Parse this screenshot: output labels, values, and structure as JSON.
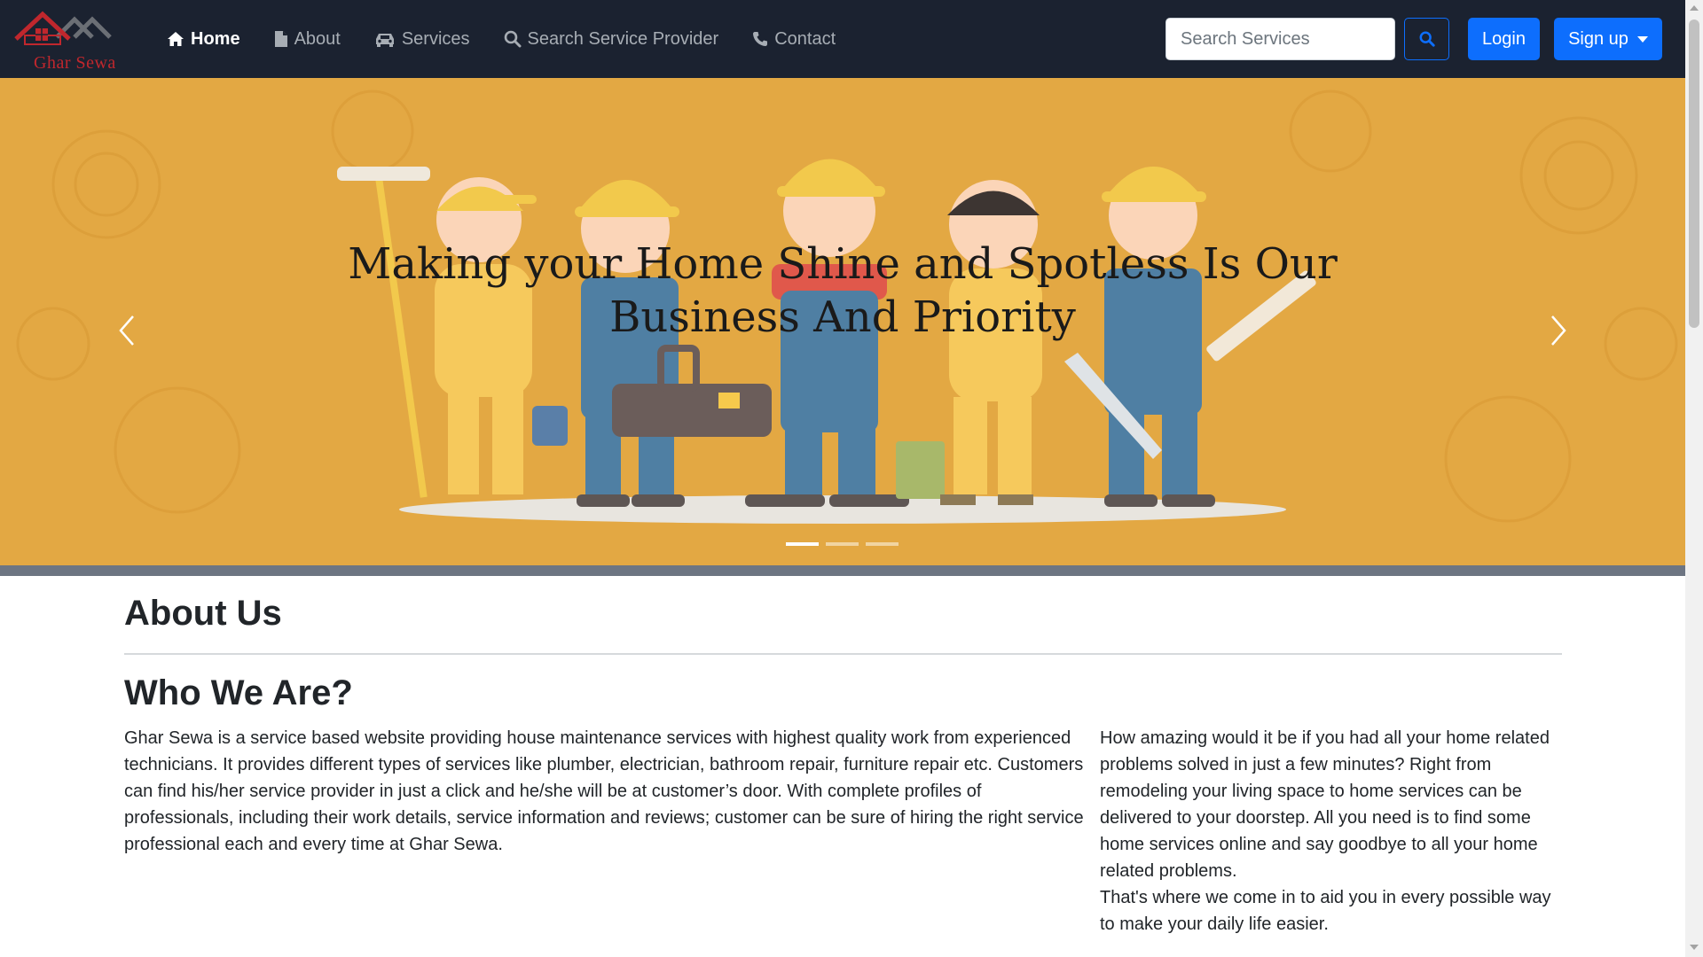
{
  "brand": {
    "name": "Ghar Sewa",
    "color": "#c0272d"
  },
  "nav": {
    "items": [
      {
        "label": "Home",
        "icon": "home-icon",
        "active": true
      },
      {
        "label": "About",
        "icon": "file-icon",
        "active": false
      },
      {
        "label": "Services",
        "icon": "car-icon",
        "active": false
      },
      {
        "label": "Search Service Provider",
        "icon": "search-icon",
        "active": false
      },
      {
        "label": "Contact",
        "icon": "phone-icon",
        "active": false
      }
    ],
    "search_placeholder": "Search Services",
    "login_label": "Login",
    "signup_label": "Sign up"
  },
  "carousel": {
    "caption": "Making your Home Shine and Spotless Is Our Business And Priority",
    "slide_count": 3,
    "active_slide": 1
  },
  "about": {
    "heading": "About Us",
    "subheading": "Who We Are?",
    "paragraph_left": "Ghar Sewa is a service based website providing house maintenance services with highest quality work from experienced technicians. It provides different types of services like plumber, electrician, bathroom repair, furniture repair etc. Customers can find his/her service provider in just a click and he/she will be at customer’s door. With complete profiles of professionals, including their work details, service information and reviews; customer can be sure of hiring the right service professional each and every time at Ghar Sewa.",
    "paragraph_right_1": "How amazing would it be if you had all your home related problems solved in just a few minutes? Right from remodeling your living space to home services can be delivered to your doorstep. All you need is to find some home services online and say goodbye to all your home related problems.",
    "paragraph_right_2": "That's where we come in to aid you in every possible way to make your daily life easier."
  },
  "colors": {
    "navbar_bg": "#1b2230",
    "primary": "#0d6efd",
    "hero_bg": "#e3a843"
  }
}
